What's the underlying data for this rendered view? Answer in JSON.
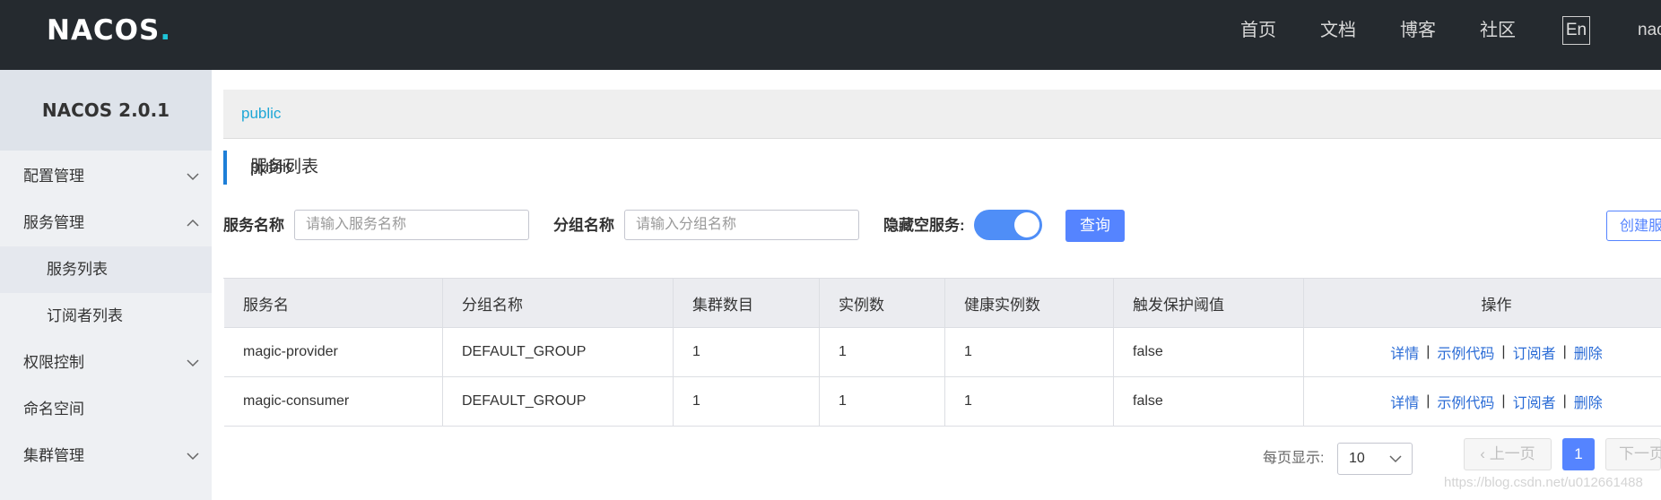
{
  "header": {
    "logo_text": "NACOS.",
    "nav": [
      "首页",
      "文档",
      "博客",
      "社区"
    ],
    "lang_button": "En",
    "user": "nac"
  },
  "sidebar": {
    "version": "NACOS 2.0.1",
    "items": [
      {
        "label": "配置管理",
        "icon": "chevron-down-icon"
      },
      {
        "label": "服务管理",
        "icon": "chevron-up-icon"
      },
      {
        "label": "服务列表"
      },
      {
        "label": "订阅者列表"
      },
      {
        "label": "权限控制",
        "icon": "chevron-down-icon"
      },
      {
        "label": "命名空间"
      },
      {
        "label": "集群管理",
        "icon": "chevron-down-icon"
      }
    ]
  },
  "namespace": {
    "current": "public"
  },
  "page": {
    "title": "服务列表",
    "separator": "|",
    "namespace": "public"
  },
  "filters": {
    "service_name_label": "服务名称",
    "service_name_placeholder": "请输入服务名称",
    "group_name_label": "分组名称",
    "group_name_placeholder": "请输入分组名称",
    "hide_empty_label": "隐藏空服务:",
    "hide_empty_on": true,
    "query_button": "查询",
    "create_button": "创建服"
  },
  "table": {
    "columns": [
      "服务名",
      "分组名称",
      "集群数目",
      "实例数",
      "健康实例数",
      "触发保护阈值",
      "操作"
    ],
    "rows": [
      {
        "service": "magic-provider",
        "group": "DEFAULT_GROUP",
        "clusters": "1",
        "instances": "1",
        "healthy": "1",
        "threshold": "false"
      },
      {
        "service": "magic-consumer",
        "group": "DEFAULT_GROUP",
        "clusters": "1",
        "instances": "1",
        "healthy": "1",
        "threshold": "false"
      }
    ],
    "ops": [
      "详情",
      "示例代码",
      "订阅者",
      "删除"
    ],
    "op_separator": "|"
  },
  "pager": {
    "page_size_label": "每页显示:",
    "page_size": "10",
    "prev": "上一页",
    "current": "1",
    "next": "下一页"
  },
  "watermark": "https://blog.csdn.net/u012661488",
  "colors": {
    "topbar": "#252a2f",
    "accent": "#5584ff",
    "link": "#2b6cd6",
    "namespace": "#1ea7d6"
  }
}
